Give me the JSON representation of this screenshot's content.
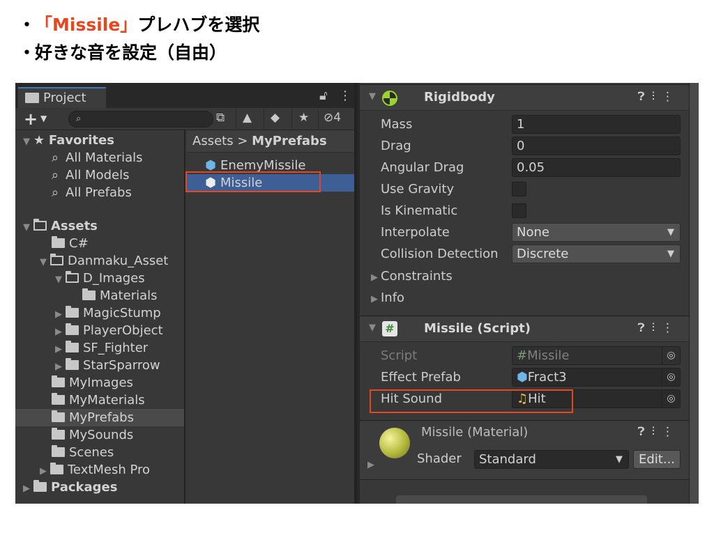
{
  "instructions": {
    "bullet": "・",
    "line1_highlight": "「Missile」",
    "line1_rest": "プレハブを選択",
    "line2": "好きな音を設定（自由）"
  },
  "project": {
    "tab_label": "Project",
    "lock_icon": "lock-icon",
    "hidden_count": "4",
    "favorites": {
      "label": "Favorites",
      "items": [
        "All Materials",
        "All Models",
        "All Prefabs"
      ]
    },
    "assets": {
      "label": "Assets",
      "c_sharp": "C#",
      "danmaku": "Danmaku_Asset",
      "d_images": "D_Images",
      "materials": "Materials",
      "magic_stump": "MagicStump",
      "player_object": "PlayerObject",
      "sf_fighter": "SF_Fighter",
      "star_sparrow": "StarSparrow",
      "my_images": "MyImages",
      "my_materials": "MyMaterials",
      "my_prefabs": "MyPrefabs",
      "my_sounds": "MySounds",
      "scenes": "Scenes",
      "textmesh_pro": "TextMesh Pro"
    },
    "packages": "Packages",
    "breadcrumb_root": "Assets",
    "breadcrumb_sep": ">",
    "breadcrumb_current": "MyPrefabs",
    "files": [
      "EnemyMissile",
      "Missile"
    ]
  },
  "rigidbody": {
    "title": "Rigidbody",
    "mass_label": "Mass",
    "mass": "1",
    "drag_label": "Drag",
    "drag": "0",
    "angular_drag_label": "Angular Drag",
    "angular_drag": "0.05",
    "use_gravity_label": "Use Gravity",
    "is_kinematic_label": "Is Kinematic",
    "interpolate_label": "Interpolate",
    "interpolate": "None",
    "collision_label": "Collision Detection",
    "collision": "Discrete",
    "constraints_label": "Constraints",
    "info_label": "Info"
  },
  "script": {
    "title": "Missile (Script)",
    "script_label": "Script",
    "script_value": "Missile",
    "effect_label": "Effect Prefab",
    "effect_value": "Fract3",
    "hit_sound_label": "Hit Sound",
    "hit_sound_value": "Hit"
  },
  "material": {
    "title": "Missile (Material)",
    "shader_label": "Shader",
    "shader_value": "Standard",
    "edit_label": "Edit..."
  },
  "colors": {
    "highlight": "#e8461f",
    "selection": "#3e5f96",
    "tab_accent": "#3a79bb"
  }
}
